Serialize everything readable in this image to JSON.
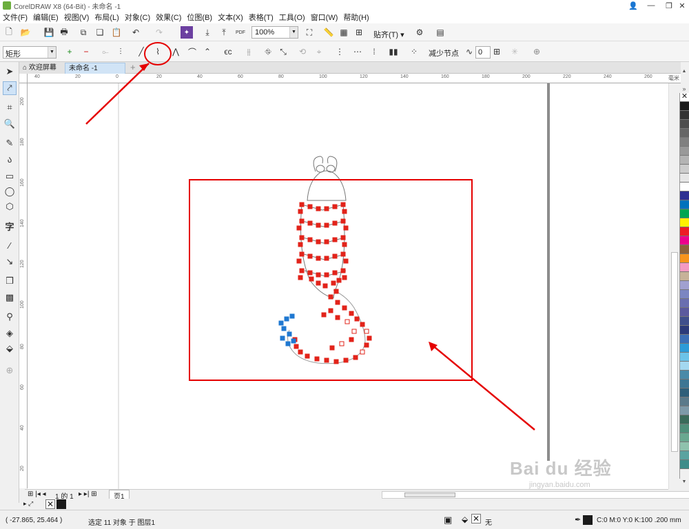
{
  "window": {
    "title": "CorelDRAW X8 (64-Bit) - 未命名 -1",
    "controls": [
      "minimize-icon",
      "restore-icon",
      "close-icon"
    ]
  },
  "menu": [
    "文件(F)",
    "编辑(E)",
    "视图(V)",
    "布局(L)",
    "对象(C)",
    "效果(C)",
    "位图(B)",
    "文本(X)",
    "表格(T)",
    "工具(O)",
    "窗口(W)",
    "帮助(H)"
  ],
  "toolbar1": {
    "zoom": "100%",
    "snap_label": "贴齐(T)"
  },
  "toolbar2": {
    "shape_select": "矩形",
    "reduce_nodes": "减少节点",
    "smoothness": "0"
  },
  "tabs": {
    "home": "欢迎屏幕",
    "doc": "未命名 -1"
  },
  "ruler": {
    "unit": "毫米",
    "h_ticks": [
      "40",
      "20",
      "0",
      "20",
      "40",
      "60",
      "80",
      "100",
      "120",
      "140",
      "160",
      "180",
      "200",
      "220",
      "240",
      "260"
    ],
    "v_ticks": [
      "200",
      "180",
      "160",
      "140",
      "120",
      "100",
      "80",
      "60",
      "40",
      "20"
    ]
  },
  "pager": {
    "page_of": "1 的 1",
    "page_tab": "页1"
  },
  "status": {
    "coords": "( -27.865, 25.464 )",
    "selection": "选定 11 对象 于 图层1",
    "fill_none": "无",
    "outline": "C:0 M:0 Y:0 K:100  .200 mm"
  },
  "palette": [
    "#ffffff",
    "#1a1a1a",
    "#333333",
    "#4d4d4d",
    "#666666",
    "#808080",
    "#999999",
    "#b3b3b3",
    "#cccccc",
    "#e6e6e6",
    "#ffffff",
    "#2e3192",
    "#0072bc",
    "#00a651",
    "#fff200",
    "#ed1c24",
    "#ec008c",
    "#8c6239",
    "#f7941d",
    "#f49ac2",
    "#c7b299",
    "#a0a0d0",
    "#7b86c2",
    "#6a6fb0",
    "#5b5a9e",
    "#3f4f8c",
    "#2b3a7a",
    "#3b6eb5",
    "#2d9bd7",
    "#6cc3e8",
    "#a3d8f0",
    "#4a8aa8",
    "#3d7694",
    "#2e5f7a",
    "#5a7a8a",
    "#7d9aa8",
    "#3a6b5a",
    "#4f8f7a",
    "#6aa890",
    "#8fc2ad",
    "#5ba3a0",
    "#3f8c89"
  ],
  "watermark": {
    "main": "Bai du 经验",
    "sub": "jingyan.baidu.com"
  },
  "colors": {
    "accent_red": "#ff0000",
    "node_red": "#e2231a",
    "node_blue": "#1f78d1"
  }
}
